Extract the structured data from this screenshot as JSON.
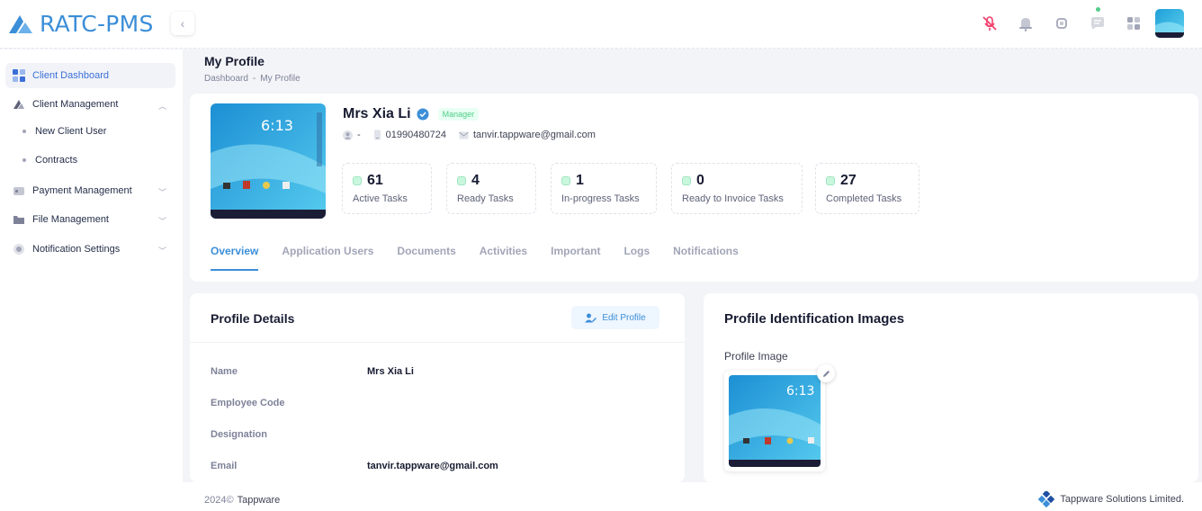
{
  "app": {
    "logo_text": "RATC-PMS"
  },
  "sidebar": {
    "items": [
      {
        "label": "Client Dashboard"
      },
      {
        "label": "Client Management"
      },
      {
        "label": "Payment Management"
      },
      {
        "label": "File Management"
      },
      {
        "label": "Notification Settings"
      }
    ],
    "sub_items": [
      {
        "label": "New Client User"
      },
      {
        "label": "Contracts"
      }
    ]
  },
  "page": {
    "title": "My Profile",
    "breadcrumb": [
      "Dashboard",
      "My Profile"
    ]
  },
  "profile": {
    "name": "Mrs Xia Li",
    "role": "Manager",
    "username": "-",
    "phone": "01990480724",
    "email": "tanvir.tappware@gmail.com",
    "stats": [
      {
        "value": "61",
        "label": "Active Tasks"
      },
      {
        "value": "4",
        "label": "Ready Tasks"
      },
      {
        "value": "1",
        "label": "In-progress Tasks"
      },
      {
        "value": "0",
        "label": "Ready to Invoice Tasks"
      },
      {
        "value": "27",
        "label": "Completed Tasks"
      }
    ],
    "tabs": [
      "Overview",
      "Application Users",
      "Documents",
      "Activities",
      "Important",
      "Logs",
      "Notifications"
    ],
    "active_tab": "Overview"
  },
  "details": {
    "title": "Profile Details",
    "edit_label": "Edit Profile",
    "rows": [
      {
        "label": "Name",
        "value": "Mrs Xia Li"
      },
      {
        "label": "Employee Code",
        "value": ""
      },
      {
        "label": "Designation",
        "value": ""
      },
      {
        "label": "Email",
        "value": "tanvir.tappware@gmail.com"
      }
    ]
  },
  "identification": {
    "title": "Profile Identification Images",
    "profile_image_label": "Profile Image"
  },
  "footer": {
    "year": "2024©",
    "owner": "Tappware",
    "company": "Tappware Solutions Limited."
  },
  "colors": {
    "brand": "#3b8ed8",
    "success": "#50cd89",
    "mic_muted": "#f1416c"
  }
}
